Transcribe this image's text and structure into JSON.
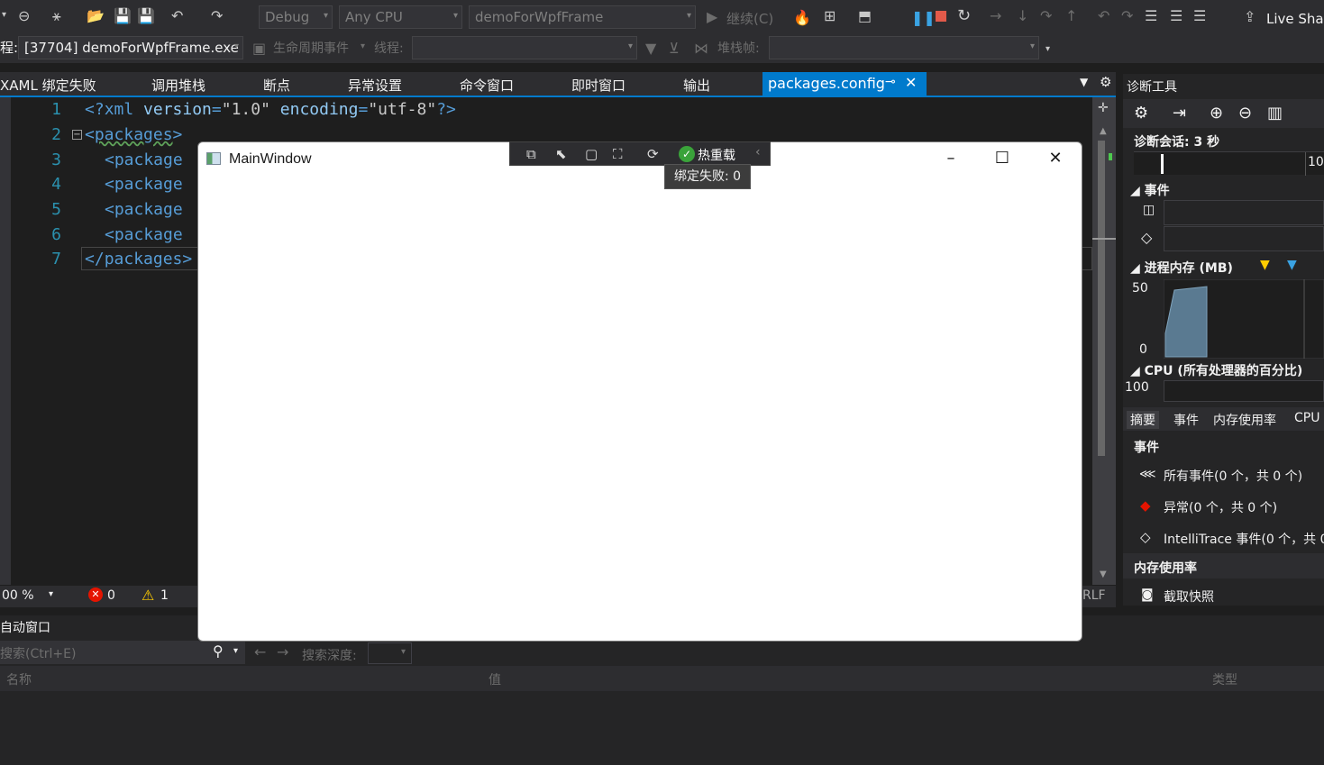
{
  "toolbar": {
    "config": "Debug",
    "platform": "Any CPU",
    "startup_project": "demoForWpfFrame",
    "continue_label": "继续(C)",
    "live_share": "Live Shar"
  },
  "debug_bar": {
    "process_label": "程:",
    "process_value": "[37704] demoForWpfFrame.exe",
    "lifecycle_label": "生命周期事件",
    "thread_label": "线程:",
    "stack_label": "堆栈帧:"
  },
  "tabs": [
    {
      "label": "XAML 绑定失败"
    },
    {
      "label": "调用堆栈"
    },
    {
      "label": "断点"
    },
    {
      "label": "异常设置"
    },
    {
      "label": "命令窗口"
    },
    {
      "label": "即时窗口"
    },
    {
      "label": "输出"
    }
  ],
  "active_tab": {
    "label": "packages.config"
  },
  "editor": {
    "lines": [
      {
        "num": "1",
        "tag_open": "<?",
        "name": "xml",
        "a1": " version",
        "eq1": "=",
        "v1": "\"1.0\"",
        "a2": " encoding",
        "eq2": "=",
        "v2": "\"utf-8\"",
        "tag_close": "?>"
      },
      {
        "num": "2",
        "text_open": "<",
        "name": "packages",
        "text_close": ">"
      },
      {
        "num": "3",
        "text": "<package"
      },
      {
        "num": "4",
        "text": "<package"
      },
      {
        "num": "5",
        "text": "<package"
      },
      {
        "num": "6",
        "text": "<package"
      },
      {
        "num": "7",
        "text_open": "</",
        "name": "packages",
        "text_close": ">"
      }
    ],
    "zoom": "00 %",
    "errors": "0",
    "warnings": "1",
    "line_ending": "RLF"
  },
  "auto_window": {
    "title": "自动窗口",
    "search_placeholder": "搜索(Ctrl+E)",
    "search_depth": "搜索深度:",
    "col_name": "名称",
    "col_value": "值",
    "col_type": "类型"
  },
  "main_window": {
    "title": "MainWindow",
    "hot_reload": "热重载",
    "binding_failures": "绑定失败: 0"
  },
  "diagnostics": {
    "title": "诊断工具",
    "session": "诊断会话: 3 秒",
    "timeline_tick": "10",
    "events_header": "事件",
    "memory_header": "进程内存 (MB)",
    "memory_max": "50",
    "memory_min": "0",
    "cpu_header": "CPU (所有处理器的百分比)",
    "cpu_max": "100",
    "tabs": [
      "摘要",
      "事件",
      "内存使用率",
      "CPU"
    ],
    "events_section": "事件",
    "all_events": "所有事件(0 个，共 0 个)",
    "exceptions": "异常(0 个，共 0 个)",
    "intellitrace": "IntelliTrace 事件(0 个，共 0",
    "memory_section": "内存使用率",
    "snapshot": "截取快照"
  },
  "colors": {
    "accent": "#007acc",
    "error": "#e51400",
    "warning": "#ffcc00",
    "memory_graph": "#5a7a91"
  }
}
